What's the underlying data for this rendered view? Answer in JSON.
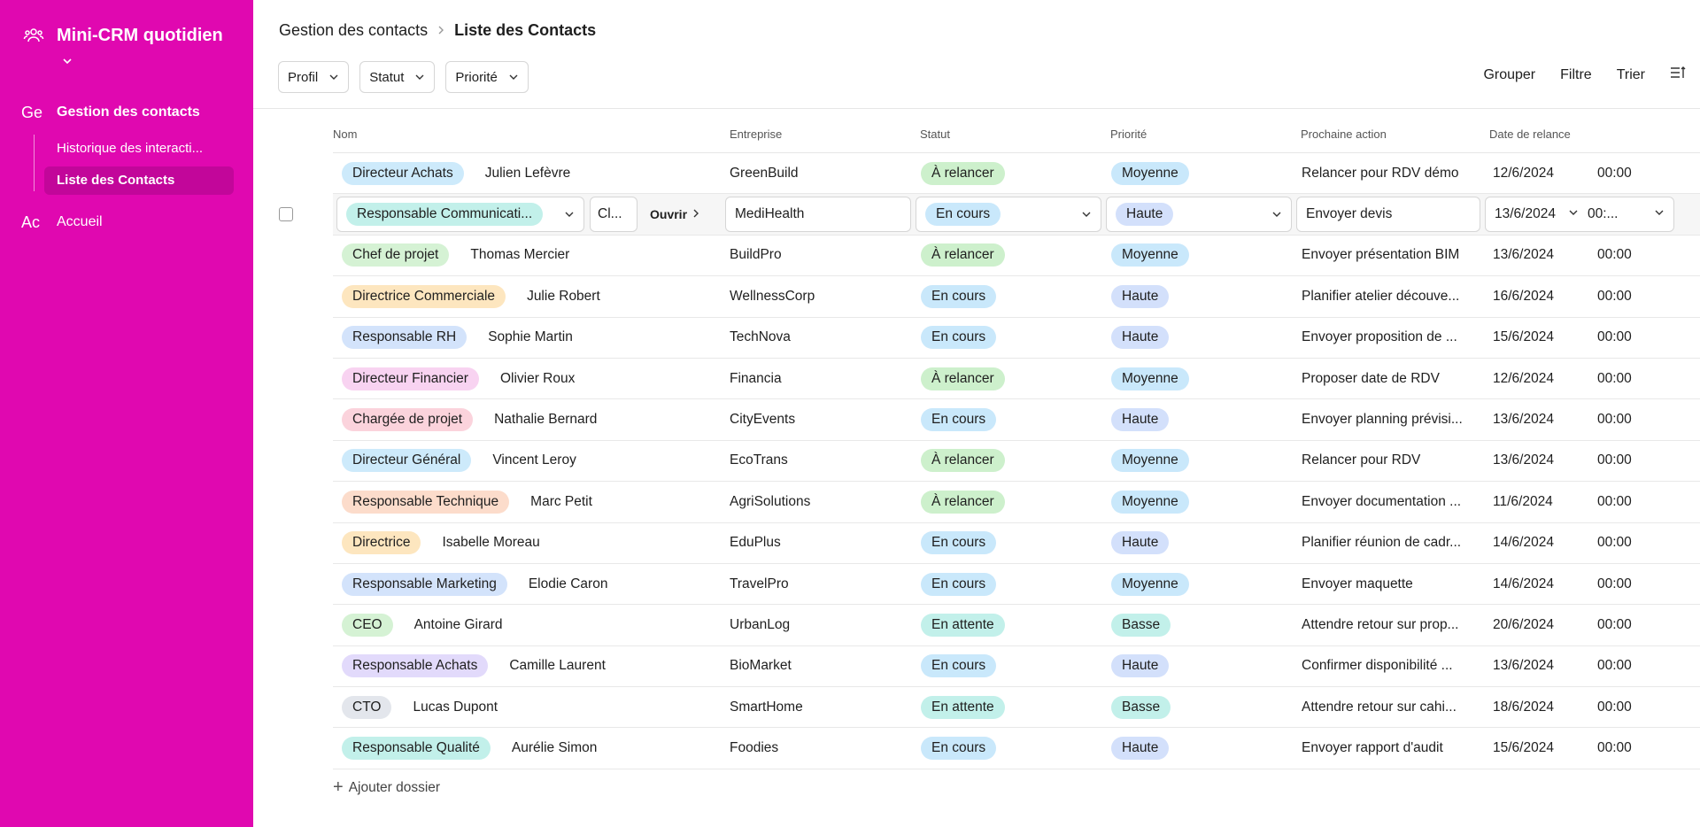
{
  "sidebar": {
    "app_title": "Mini-CRM quotidien",
    "nav": [
      {
        "abbr": "Ge",
        "label": "Gestion des contacts"
      },
      {
        "abbr": "Ac",
        "label": "Accueil"
      }
    ],
    "subnav": [
      {
        "label": "Historique des interacti..."
      },
      {
        "label": "Liste des Contacts"
      }
    ]
  },
  "header": {
    "breadcrumb_parent": "Gestion des contacts",
    "breadcrumb_current": "Liste des Contacts",
    "filters": [
      "Profil",
      "Statut",
      "Priorité"
    ],
    "actions": [
      "Grouper",
      "Filtre",
      "Trier"
    ]
  },
  "table": {
    "columns": [
      "Nom",
      "Entreprise",
      "Statut",
      "Priorité",
      "Prochaine action",
      "Date de relance"
    ],
    "rows": [
      {
        "role": "Directeur Achats",
        "role_color": "#cdeafb",
        "name": "Julien Lefèvre",
        "company": "GreenBuild",
        "status": "À relancer",
        "priority": "Moyenne",
        "action": "Relancer pour RDV démo",
        "date": "12/6/2024",
        "time": "00:00"
      },
      {
        "role": "Responsable Communicati...",
        "role_color": "#c2f0ea",
        "name": "Cl...",
        "open": "Ouvrir",
        "company": "MediHealth",
        "status": "En cours",
        "priority": "Haute",
        "action": "Envoyer devis",
        "date": "13/6/2024",
        "time": "00:..."
      },
      {
        "role": "Chef de projet",
        "role_color": "#d5f2d4",
        "name": "Thomas Mercier",
        "company": "BuildPro",
        "status": "À relancer",
        "priority": "Moyenne",
        "action": "Envoyer présentation BIM",
        "date": "13/6/2024",
        "time": "00:00"
      },
      {
        "role": "Directrice Commerciale",
        "role_color": "#fde6bf",
        "name": "Julie Robert",
        "company": "WellnessCorp",
        "status": "En cours",
        "priority": "Haute",
        "action": "Planifier atelier découve...",
        "date": "16/6/2024",
        "time": "00:00"
      },
      {
        "role": "Responsable RH",
        "role_color": "#d3e3fb",
        "name": "Sophie Martin",
        "company": "TechNova",
        "status": "En cours",
        "priority": "Haute",
        "action": "Envoyer proposition de ...",
        "date": "15/6/2024",
        "time": "00:00"
      },
      {
        "role": "Directeur Financier",
        "role_color": "#f8d3f1",
        "name": "Olivier Roux",
        "company": "Financia",
        "status": "À relancer",
        "priority": "Moyenne",
        "action": "Proposer date de RDV",
        "date": "12/6/2024",
        "time": "00:00"
      },
      {
        "role": "Chargée de projet",
        "role_color": "#fbd3dc",
        "name": "Nathalie Bernard",
        "company": "CityEvents",
        "status": "En cours",
        "priority": "Haute",
        "action": "Envoyer planning prévisi...",
        "date": "13/6/2024",
        "time": "00:00"
      },
      {
        "role": "Directeur Général",
        "role_color": "#cdeafb",
        "name": "Vincent Leroy",
        "company": "EcoTrans",
        "status": "À relancer",
        "priority": "Moyenne",
        "action": "Relancer pour RDV",
        "date": "13/6/2024",
        "time": "00:00"
      },
      {
        "role": "Responsable Technique",
        "role_color": "#fcdccb",
        "name": "Marc Petit",
        "company": "AgriSolutions",
        "status": "À relancer",
        "priority": "Moyenne",
        "action": "Envoyer documentation ...",
        "date": "11/6/2024",
        "time": "00:00"
      },
      {
        "role": "Directrice",
        "role_color": "#fde6bf",
        "name": "Isabelle Moreau",
        "company": "EduPlus",
        "status": "En cours",
        "priority": "Haute",
        "action": "Planifier réunion de cadr...",
        "date": "14/6/2024",
        "time": "00:00"
      },
      {
        "role": "Responsable Marketing",
        "role_color": "#d3e3fb",
        "name": "Elodie Caron",
        "company": "TravelPro",
        "status": "En cours",
        "priority": "Moyenne",
        "action": "Envoyer maquette",
        "date": "14/6/2024",
        "time": "00:00"
      },
      {
        "role": "CEO",
        "role_color": "#d5f2d4",
        "name": "Antoine Girard",
        "company": "UrbanLog",
        "status": "En attente",
        "priority": "Basse",
        "action": "Attendre retour sur prop...",
        "date": "20/6/2024",
        "time": "00:00"
      },
      {
        "role": "Responsable Achats",
        "role_color": "#e2dafb",
        "name": "Camille Laurent",
        "company": "BioMarket",
        "status": "En cours",
        "priority": "Haute",
        "action": "Confirmer disponibilité ...",
        "date": "13/6/2024",
        "time": "00:00"
      },
      {
        "role": "CTO",
        "role_color": "#e3e6ec",
        "name": "Lucas Dupont",
        "company": "SmartHome",
        "status": "En attente",
        "priority": "Basse",
        "action": "Attendre retour sur cahi...",
        "date": "18/6/2024",
        "time": "00:00"
      },
      {
        "role": "Responsable Qualité",
        "role_color": "#c2f0ea",
        "name": "Aurélie Simon",
        "company": "Foodies",
        "status": "En cours",
        "priority": "Haute",
        "action": "Envoyer rapport d'audit",
        "date": "15/6/2024",
        "time": "00:00"
      }
    ],
    "add_label": "Ajouter dossier"
  },
  "colors": {
    "sidebar_bg": "#e008b0",
    "status_a_relancer": "#cdf0cc",
    "status_en_cours": "#c9e8fb",
    "status_en_attente": "#c2f0ea",
    "priority_moyenne": "#c9e8fb",
    "priority_haute": "#d3e0fb",
    "priority_basse": "#c2f0ea"
  }
}
